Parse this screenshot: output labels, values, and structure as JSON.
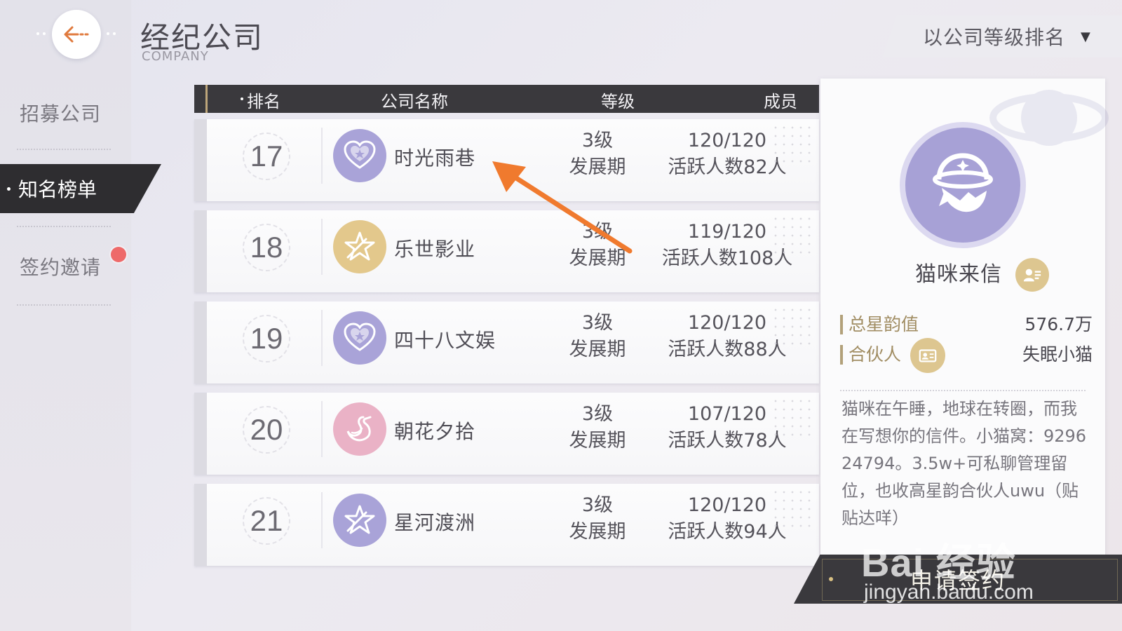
{
  "header": {
    "title": "经纪公司",
    "subtitle": "COMPANY"
  },
  "sidebar": {
    "items": [
      {
        "label": "招募公司",
        "active": false
      },
      {
        "label": "知名榜单",
        "active": true
      },
      {
        "label": "签约邀请",
        "active": false,
        "has_notification": true
      }
    ]
  },
  "sort": {
    "label": "以公司等级排名"
  },
  "table": {
    "headers": {
      "rank": "排名",
      "name": "公司名称",
      "level": "等级",
      "members": "成员"
    },
    "rows": [
      {
        "rank": "17",
        "name": "时光雨巷",
        "level": "3级",
        "stage": "发展期",
        "members": "120/120",
        "active": "活跃人数82人",
        "logo": "heart-logo",
        "logo_color": "#a9a3d8"
      },
      {
        "rank": "18",
        "name": "乐世影业",
        "level": "3级",
        "stage": "发展期",
        "members": "119/120",
        "active": "活跃人数108人",
        "logo": "star-logo",
        "logo_color": "#e3c88c"
      },
      {
        "rank": "19",
        "name": "四十八文娱",
        "level": "3级",
        "stage": "发展期",
        "members": "120/120",
        "active": "活跃人数88人",
        "logo": "heart-logo",
        "logo_color": "#a9a3d8"
      },
      {
        "rank": "20",
        "name": "朝花夕拾",
        "level": "3级",
        "stage": "发展期",
        "members": "107/120",
        "active": "活跃人数78人",
        "logo": "swan-logo",
        "logo_color": "#eab2c6"
      },
      {
        "rank": "21",
        "name": "星河渡洲",
        "level": "3级",
        "stage": "发展期",
        "members": "120/120",
        "active": "活跃人数94人",
        "logo": "star-logo",
        "logo_color": "#a9a3d8"
      }
    ]
  },
  "detail": {
    "name": "猫咪来信",
    "total_label": "总星韵值",
    "total_value": "576.7万",
    "partner_label": "合伙人",
    "partner_value": "失眠小猫",
    "description": "猫咪在午睡，地球在转圈，而我在写想你的信件。小猫窝：929624794。3.5w+可私聊管理留位，也收高星韵合伙人uwu（贴贴达咩）",
    "apply_label": "申请签约"
  },
  "watermark": {
    "brand": "Bai 经验",
    "url": "jingyan.baidu.com"
  },
  "colors": {
    "accent_gold": "#b2a17a",
    "dark_bar": "#3a393d",
    "arrow": "#f07a2e",
    "notification": "#ee6a6a"
  }
}
